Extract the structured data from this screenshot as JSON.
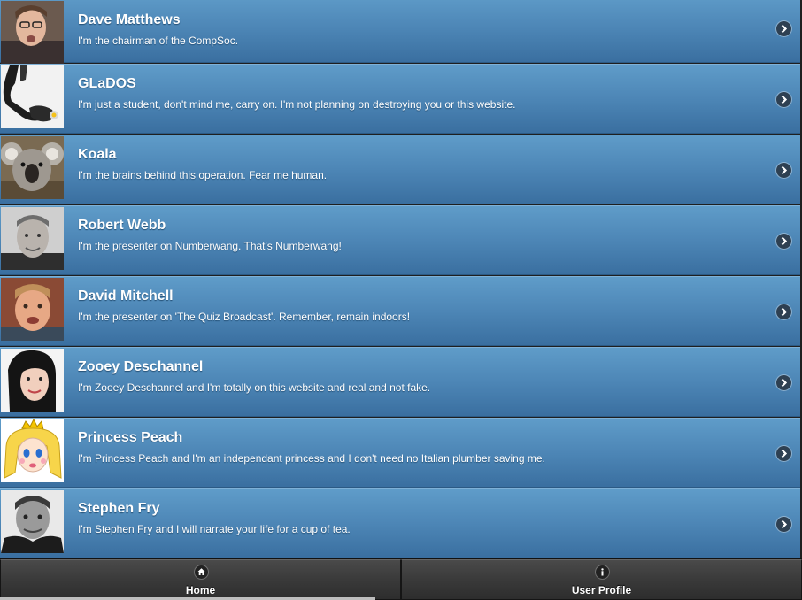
{
  "users": [
    {
      "name": "Dave Matthews",
      "bio": "I'm the chairman of the CompSoc.",
      "avatar_icon": "person-photo-icon"
    },
    {
      "name": "GLaDOS",
      "bio": "I'm just a student, don't mind me, carry on. I'm not planning on destroying you or this website.",
      "avatar_icon": "robot-photo-icon"
    },
    {
      "name": "Koala",
      "bio": "I'm the brains behind this operation. Fear me human.",
      "avatar_icon": "koala-photo-icon"
    },
    {
      "name": "Robert Webb",
      "bio": "I'm the presenter on Numberwang. That's Numberwang!",
      "avatar_icon": "person-photo-icon"
    },
    {
      "name": "David Mitchell",
      "bio": "I'm the presenter on 'The Quiz Broadcast'. Remember, remain indoors!",
      "avatar_icon": "person-photo-icon"
    },
    {
      "name": "Zooey Deschannel",
      "bio": "I'm Zooey Deschannel and I'm totally on this website and real and not fake.",
      "avatar_icon": "person-photo-icon"
    },
    {
      "name": "Princess Peach",
      "bio": "I'm Princess Peach and I'm an independant princess and I don't need no Italian plumber saving me.",
      "avatar_icon": "cartoon-princess-icon"
    },
    {
      "name": "Stephen Fry",
      "bio": "I'm Stephen Fry and I will narrate your life for a cup of tea.",
      "avatar_icon": "person-photo-icon"
    }
  ],
  "navbar": {
    "home_label": "Home",
    "home_icon": "home-icon",
    "profile_label": "User Profile",
    "profile_icon": "info-icon"
  },
  "colors": {
    "row_top": "#5f9cc9",
    "row_bottom": "#3a6fa0",
    "navbar": "#3a3a3a"
  }
}
